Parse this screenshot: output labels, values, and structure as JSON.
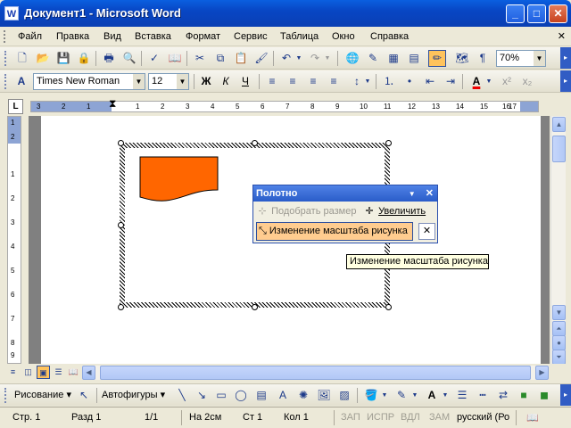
{
  "window": {
    "title": "Документ1 - Microsoft Word",
    "app_icon": "W",
    "minimize": "_",
    "maximize": "□",
    "close": "✕"
  },
  "menu": {
    "items": [
      "Файл",
      "Правка",
      "Вид",
      "Вставка",
      "Формат",
      "Сервис",
      "Таблица",
      "Окно",
      "Справка"
    ],
    "close_doc": "✕"
  },
  "toolbar_standard": {
    "icons": [
      "new-icon",
      "open-icon",
      "save-icon",
      "permission-icon",
      "print-icon",
      "print-preview-icon",
      "spelling-icon",
      "research-icon",
      "cut-icon",
      "copy-icon",
      "paste-icon",
      "format-painter-icon",
      "undo-icon",
      "redo-icon",
      "hyperlink-icon",
      "tables-borders-icon",
      "insert-table-icon",
      "insert-excel-icon",
      "drawing-icon",
      "document-map-icon",
      "show-hide-icon"
    ],
    "zoom": "70%",
    "paragraph_mark": "¶"
  },
  "toolbar_format": {
    "style_glyph": "A",
    "font": "Times New Roman",
    "size": "12",
    "bold": "Ж",
    "italic": "К",
    "underline": "Ч",
    "font_color_glyph": "A",
    "superscript": "x²",
    "subscript": "x₂"
  },
  "ruler": {
    "tab_selector": "L",
    "h_labels": [
      "3",
      "2",
      "1",
      "1",
      "2",
      "3",
      "4",
      "5",
      "6",
      "7",
      "8",
      "9",
      "10",
      "11",
      "12",
      "13",
      "14",
      "15",
      "16",
      "17"
    ],
    "v_labels": [
      "1",
      "2",
      "1",
      "2",
      "3",
      "4",
      "5",
      "6",
      "7",
      "8",
      "9"
    ]
  },
  "canvas_panel": {
    "title": "Полотно",
    "fit_label": "Подобрать размер",
    "expand_label": "Увеличить",
    "scale_label": "Изменение масштаба рисунка",
    "dropdown": "▼",
    "close": "✕"
  },
  "tooltip": "Изменение масштаба рисунка",
  "shape": {
    "fill": "#ff6600",
    "stroke": "#000000"
  },
  "drawing_toolbar": {
    "draw_label": "Рисование",
    "autoshapes_label": "Автофигуры"
  },
  "status": {
    "page": "Стр.  1",
    "section": "Разд  1",
    "pages": "1/1",
    "at": "На  2см",
    "line": "Ст  1",
    "col": "Кол  1",
    "rec": "ЗАП",
    "trk": "ИСПР",
    "ext": "ВДЛ",
    "ovr": "ЗАМ",
    "lang": "русский (Ро"
  },
  "colors": {
    "title_bar": "#0a4fd0",
    "selection": "#ffc35c",
    "highlight_row": "#ffcc8f"
  }
}
